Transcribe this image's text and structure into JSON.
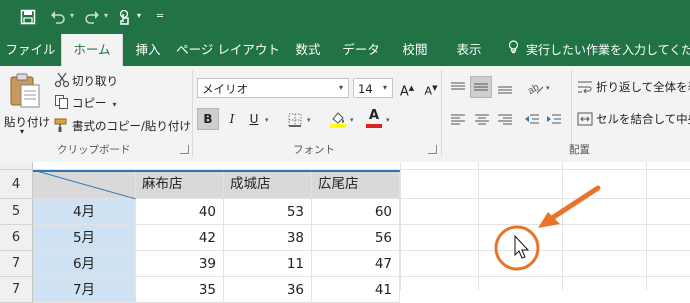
{
  "tabs": [
    {
      "label": "ファイル"
    },
    {
      "label": "ホーム"
    },
    {
      "label": "挿入"
    },
    {
      "label": "ページ レイアウト"
    },
    {
      "label": "数式"
    },
    {
      "label": "データ"
    },
    {
      "label": "校閲"
    },
    {
      "label": "表示"
    }
  ],
  "tell_me": "実行したい作業を入力してください",
  "clipboard": {
    "paste": "貼り付け",
    "cut": "切り取り",
    "copy": "コピー",
    "format_painter": "書式のコピー/貼り付け",
    "label": "クリップボード"
  },
  "font": {
    "name": "メイリオ",
    "size": "14",
    "bold": "B",
    "italic": "I",
    "underline": "U",
    "font_color_letter": "A",
    "grow_letter": "A",
    "shrink_letter": "A",
    "label": "フォント"
  },
  "alignment": {
    "wrap": "折り返して全体を表",
    "merge": "セルを結合して中央",
    "label": "配置"
  },
  "sheet": {
    "row_numbers": [
      "4",
      "5",
      "6",
      "7",
      "7"
    ],
    "headers": [
      "麻布店",
      "成城店",
      "広尾店"
    ],
    "rows": [
      {
        "month": "4月",
        "values": [
          "40",
          "53",
          "60"
        ]
      },
      {
        "month": "5月",
        "values": [
          "42",
          "38",
          "56"
        ]
      },
      {
        "month": "6月",
        "values": [
          "39",
          "11",
          "47"
        ]
      },
      {
        "month": "7月",
        "values": [
          "35",
          "36",
          "41"
        ]
      }
    ]
  },
  "colors": {
    "excel_green": "#217346",
    "ribbon_bg": "#f3f3f3",
    "annotation_orange": "#e8742b",
    "month_cell_blue": "#cfe2f3",
    "header_gray": "#d9d9d9",
    "table_border_blue": "#2e75b6"
  }
}
